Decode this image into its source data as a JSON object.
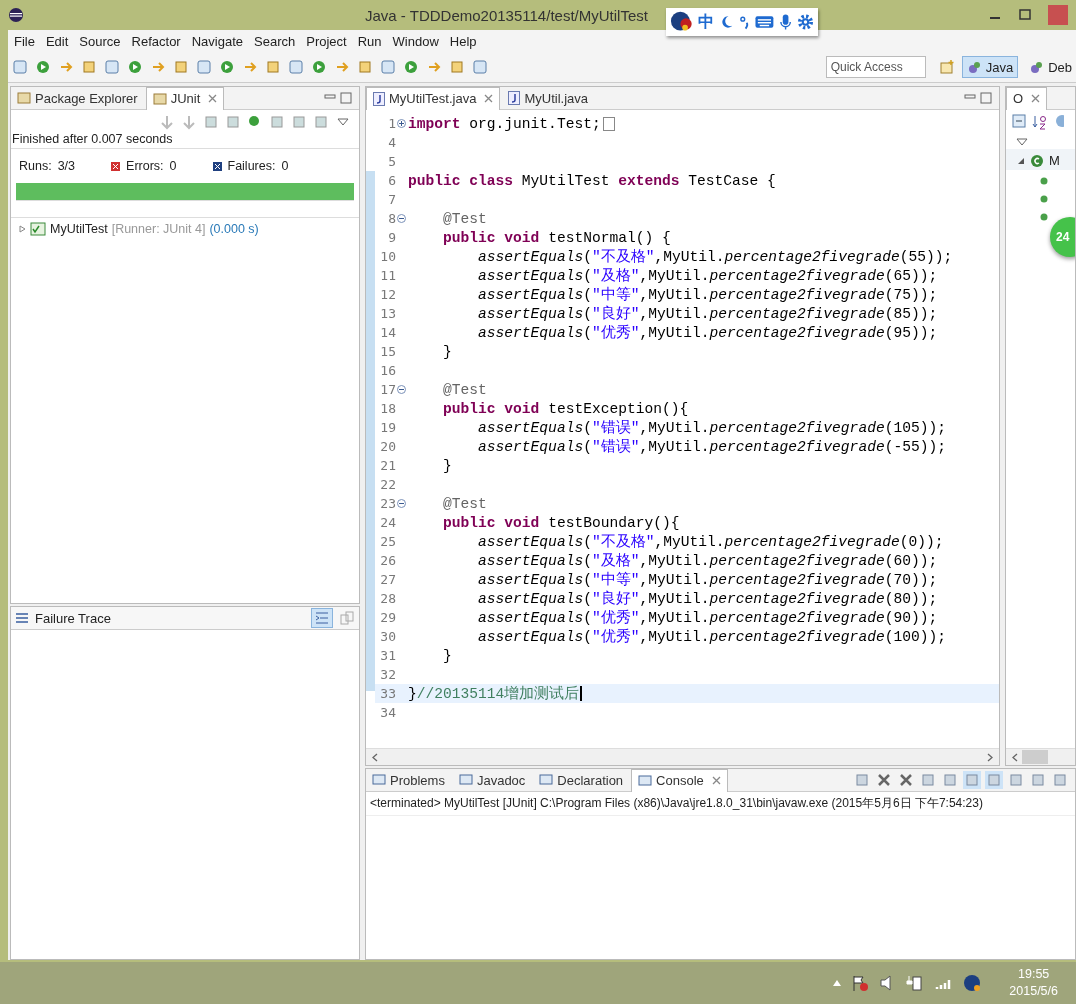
{
  "window": {
    "title": "Java - TDDDemo20135114/test/MyUtilTest"
  },
  "ime": {
    "mode": "中"
  },
  "menu": [
    "File",
    "Edit",
    "Source",
    "Refactor",
    "Navigate",
    "Search",
    "Project",
    "Run",
    "Window",
    "Help"
  ],
  "quick_access": {
    "placeholder": "Quick Access"
  },
  "perspectives": [
    {
      "label": "Java",
      "selected": true
    },
    {
      "label": "Deb",
      "selected": false
    }
  ],
  "left_tabs": [
    {
      "label": "Package Explorer",
      "selected": false
    },
    {
      "label": "JUnit",
      "selected": true
    }
  ],
  "junit": {
    "status": "Finished after 0.007 seconds",
    "runs_label": "Runs:",
    "runs": "3/3",
    "errors_label": "Errors:",
    "errors": "0",
    "failures_label": "Failures:",
    "failures": "0",
    "level": 1,
    "tree": [
      {
        "name": "MyUtilTest",
        "runner": "[Runner: JUnit 4]",
        "time": "(0.000 s)",
        "expanded": false
      }
    ],
    "failure_trace": "Failure Trace"
  },
  "editor_tabs": [
    {
      "label": "MyUtilTest.java",
      "selected": true
    },
    {
      "label": "MyUtil.java",
      "selected": false
    }
  ],
  "code": [
    {
      "n": "1",
      "collapsed": true,
      "tokens": [
        {
          "kind": "kw",
          "text": "import"
        },
        {
          "kind": "plain",
          "text": " org.junit.Test;"
        }
      ]
    },
    {
      "n": "4"
    },
    {
      "n": "5"
    },
    {
      "n": "6",
      "tokens": [
        {
          "kind": "kw",
          "text": "public class"
        },
        {
          "kind": "plain",
          "text": " MyUtilTest "
        },
        {
          "kind": "kw",
          "text": "extends"
        },
        {
          "kind": "plain",
          "text": " TestCase {"
        }
      ]
    },
    {
      "n": "7"
    },
    {
      "n": "8",
      "collapsed": false,
      "tokens": [
        {
          "kind": "ann",
          "text": "    @Test"
        }
      ]
    },
    {
      "n": "9",
      "tokens": [
        {
          "kind": "kw",
          "text": "    public void"
        },
        {
          "kind": "plain",
          "text": " testNormal() {"
        }
      ]
    },
    {
      "n": "10",
      "tokens": [
        {
          "kind": "call",
          "text": "        assertEquals"
        },
        {
          "kind": "plain",
          "text": "("
        },
        {
          "kind": "str",
          "text": "\"不及格\""
        },
        {
          "kind": "plain",
          "text": ",MyUtil."
        },
        {
          "kind": "call",
          "text": "percentage2fivegrade"
        },
        {
          "kind": "plain",
          "text": "(55));"
        }
      ]
    },
    {
      "n": "11",
      "tokens": [
        {
          "kind": "call",
          "text": "        assertEquals"
        },
        {
          "kind": "plain",
          "text": "("
        },
        {
          "kind": "str",
          "text": "\"及格\""
        },
        {
          "kind": "plain",
          "text": ",MyUtil."
        },
        {
          "kind": "call",
          "text": "percentage2fivegrade"
        },
        {
          "kind": "plain",
          "text": "(65));"
        }
      ]
    },
    {
      "n": "12",
      "tokens": [
        {
          "kind": "call",
          "text": "        assertEquals"
        },
        {
          "kind": "plain",
          "text": "("
        },
        {
          "kind": "str",
          "text": "\"中等\""
        },
        {
          "kind": "plain",
          "text": ",MyUtil."
        },
        {
          "kind": "call",
          "text": "percentage2fivegrade"
        },
        {
          "kind": "plain",
          "text": "(75));"
        }
      ]
    },
    {
      "n": "13",
      "tokens": [
        {
          "kind": "call",
          "text": "        assertEquals"
        },
        {
          "kind": "plain",
          "text": "("
        },
        {
          "kind": "str",
          "text": "\"良好\""
        },
        {
          "kind": "plain",
          "text": ",MyUtil."
        },
        {
          "kind": "call",
          "text": "percentage2fivegrade"
        },
        {
          "kind": "plain",
          "text": "(85));"
        }
      ]
    },
    {
      "n": "14",
      "tokens": [
        {
          "kind": "call",
          "text": "        assertEquals"
        },
        {
          "kind": "plain",
          "text": "("
        },
        {
          "kind": "str",
          "text": "\"优秀\""
        },
        {
          "kind": "plain",
          "text": ",MyUtil."
        },
        {
          "kind": "call",
          "text": "percentage2fivegrade"
        },
        {
          "kind": "plain",
          "text": "(95));"
        }
      ]
    },
    {
      "n": "15",
      "tokens": [
        {
          "kind": "plain",
          "text": "    }"
        }
      ]
    },
    {
      "n": "16"
    },
    {
      "n": "17",
      "collapsed": false,
      "tokens": [
        {
          "kind": "ann",
          "text": "    @Test"
        }
      ]
    },
    {
      "n": "18",
      "tokens": [
        {
          "kind": "kw",
          "text": "    public void"
        },
        {
          "kind": "plain",
          "text": " testException(){"
        }
      ]
    },
    {
      "n": "19",
      "tokens": [
        {
          "kind": "call",
          "text": "        assertEquals"
        },
        {
          "kind": "plain",
          "text": "("
        },
        {
          "kind": "str",
          "text": "\"错误\""
        },
        {
          "kind": "plain",
          "text": ",MyUtil."
        },
        {
          "kind": "call",
          "text": "percentage2fivegrade"
        },
        {
          "kind": "plain",
          "text": "(105));"
        }
      ]
    },
    {
      "n": "20",
      "tokens": [
        {
          "kind": "call",
          "text": "        assertEquals"
        },
        {
          "kind": "plain",
          "text": "("
        },
        {
          "kind": "str",
          "text": "\"错误\""
        },
        {
          "kind": "plain",
          "text": ",MyUtil."
        },
        {
          "kind": "call",
          "text": "percentage2fivegrade"
        },
        {
          "kind": "plain",
          "text": "(-55));"
        }
      ]
    },
    {
      "n": "21",
      "tokens": [
        {
          "kind": "plain",
          "text": "    }"
        }
      ]
    },
    {
      "n": "22"
    },
    {
      "n": "23",
      "collapsed": false,
      "tokens": [
        {
          "kind": "ann",
          "text": "    @Test"
        }
      ]
    },
    {
      "n": "24",
      "tokens": [
        {
          "kind": "kw",
          "text": "    public void"
        },
        {
          "kind": "plain",
          "text": " testBoundary(){"
        }
      ]
    },
    {
      "n": "25",
      "tokens": [
        {
          "kind": "call",
          "text": "        assertEquals"
        },
        {
          "kind": "plain",
          "text": "("
        },
        {
          "kind": "str",
          "text": "\"不及格\""
        },
        {
          "kind": "plain",
          "text": ",MyUtil."
        },
        {
          "kind": "call",
          "text": "percentage2fivegrade"
        },
        {
          "kind": "plain",
          "text": "(0));"
        }
      ]
    },
    {
      "n": "26",
      "tokens": [
        {
          "kind": "call",
          "text": "        assertEquals"
        },
        {
          "kind": "plain",
          "text": "("
        },
        {
          "kind": "str",
          "text": "\"及格\""
        },
        {
          "kind": "plain",
          "text": ",MyUtil."
        },
        {
          "kind": "call",
          "text": "percentage2fivegrade"
        },
        {
          "kind": "plain",
          "text": "(60));"
        }
      ]
    },
    {
      "n": "27",
      "tokens": [
        {
          "kind": "call",
          "text": "        assertEquals"
        },
        {
          "kind": "plain",
          "text": "("
        },
        {
          "kind": "str",
          "text": "\"中等\""
        },
        {
          "kind": "plain",
          "text": ",MyUtil."
        },
        {
          "kind": "call",
          "text": "percentage2fivegrade"
        },
        {
          "kind": "plain",
          "text": "(70));"
        }
      ]
    },
    {
      "n": "28",
      "tokens": [
        {
          "kind": "call",
          "text": "        assertEquals"
        },
        {
          "kind": "plain",
          "text": "("
        },
        {
          "kind": "str",
          "text": "\"良好\""
        },
        {
          "kind": "plain",
          "text": ",MyUtil."
        },
        {
          "kind": "call",
          "text": "percentage2fivegrade"
        },
        {
          "kind": "plain",
          "text": "(80));"
        }
      ]
    },
    {
      "n": "29",
      "tokens": [
        {
          "kind": "call",
          "text": "        assertEquals"
        },
        {
          "kind": "plain",
          "text": "("
        },
        {
          "kind": "str",
          "text": "\"优秀\""
        },
        {
          "kind": "plain",
          "text": ",MyUtil."
        },
        {
          "kind": "call",
          "text": "percentage2fivegrade"
        },
        {
          "kind": "plain",
          "text": "(90));"
        }
      ]
    },
    {
      "n": "30",
      "tokens": [
        {
          "kind": "call",
          "text": "        assertEquals"
        },
        {
          "kind": "plain",
          "text": "("
        },
        {
          "kind": "str",
          "text": "\"优秀\""
        },
        {
          "kind": "plain",
          "text": ",MyUtil."
        },
        {
          "kind": "call",
          "text": "percentage2fivegrade"
        },
        {
          "kind": "plain",
          "text": "(100));"
        }
      ]
    },
    {
      "n": "31",
      "tokens": [
        {
          "kind": "plain",
          "text": "    }"
        }
      ]
    },
    {
      "n": "32"
    },
    {
      "n": "33",
      "current": true,
      "tokens": [
        {
          "kind": "plain",
          "text": "}"
        },
        {
          "kind": "comment",
          "text": "//20135114增加测试后"
        }
      ]
    },
    {
      "n": "34"
    }
  ],
  "outline": {
    "tab": "O",
    "tree": [
      {
        "name": "M",
        "expanded": true,
        "children": [
          {
            "kind": "method"
          },
          {
            "kind": "method"
          },
          {
            "kind": "method"
          }
        ]
      }
    ],
    "badge": "24"
  },
  "bottom_tabs": [
    {
      "label": "Problems",
      "selected": false
    },
    {
      "label": "Javadoc",
      "selected": false
    },
    {
      "label": "Declaration",
      "selected": false
    },
    {
      "label": "Console",
      "selected": true
    }
  ],
  "console": {
    "header": "<terminated> MyUtilTest [JUnit] C:\\Program Files (x86)\\Java\\jre1.8.0_31\\bin\\javaw.exe (2015年5月6日 下午7:54:23)"
  },
  "taskbar": {
    "time": "19:55",
    "date": "2015/5/6"
  }
}
